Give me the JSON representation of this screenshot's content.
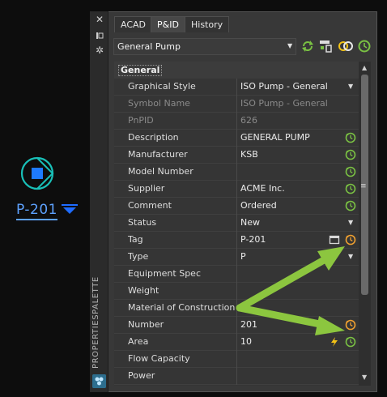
{
  "canvas": {
    "tag_label": "P-201"
  },
  "palette": {
    "vertical_title": "PROPERTIESPALETTE",
    "side_icons": [
      "close-icon",
      "pin-icon",
      "settings-icon"
    ],
    "tabs": [
      {
        "label": "ACAD",
        "active": false
      },
      {
        "label": "P&ID",
        "active": true
      },
      {
        "label": "History",
        "active": false
      }
    ],
    "class_selector": {
      "value": "General Pump"
    },
    "section": "General",
    "rows": [
      {
        "label": "Graphical Style",
        "value": "ISO Pump - General",
        "dropdown": true
      },
      {
        "label": "Symbol Name",
        "value": "ISO Pump - General",
        "dim": true
      },
      {
        "label": "PnPID",
        "value": "626",
        "dim": true
      },
      {
        "label": "Description",
        "value": "GENERAL PUMP",
        "icon": "green-clock-icon"
      },
      {
        "label": "Manufacturer",
        "value": "KSB",
        "icon": "green-clock-icon"
      },
      {
        "label": "Model Number",
        "value": "",
        "icon": "green-clock-icon"
      },
      {
        "label": "Supplier",
        "value": "ACME Inc.",
        "icon": "green-clock-icon"
      },
      {
        "label": "Comment",
        "value": "Ordered",
        "icon": "green-clock-icon"
      },
      {
        "label": "Status",
        "value": "New",
        "dropdown": true
      },
      {
        "label": "Tag",
        "value": "P-201",
        "icon": "orange-clock-icon",
        "extra_icon": "tag-editor-icon"
      },
      {
        "label": "Type",
        "value": "P",
        "dropdown": true
      },
      {
        "label": "Equipment Spec",
        "value": ""
      },
      {
        "label": "Weight",
        "value": ""
      },
      {
        "label": "Material of Construction",
        "value": ""
      },
      {
        "label": "Number",
        "value": "201",
        "icon": "orange-clock-icon"
      },
      {
        "label": "Area",
        "value": "10",
        "icon": "green-clock-icon",
        "extra_icon": "lightning-icon"
      },
      {
        "label": "Flow Capacity",
        "value": ""
      },
      {
        "label": "Power",
        "value": ""
      }
    ]
  },
  "colors": {
    "green": "#7ac143",
    "orange": "#f0a030",
    "arrow": "#8cc63f",
    "tag_blue": "#5ea2ff"
  }
}
